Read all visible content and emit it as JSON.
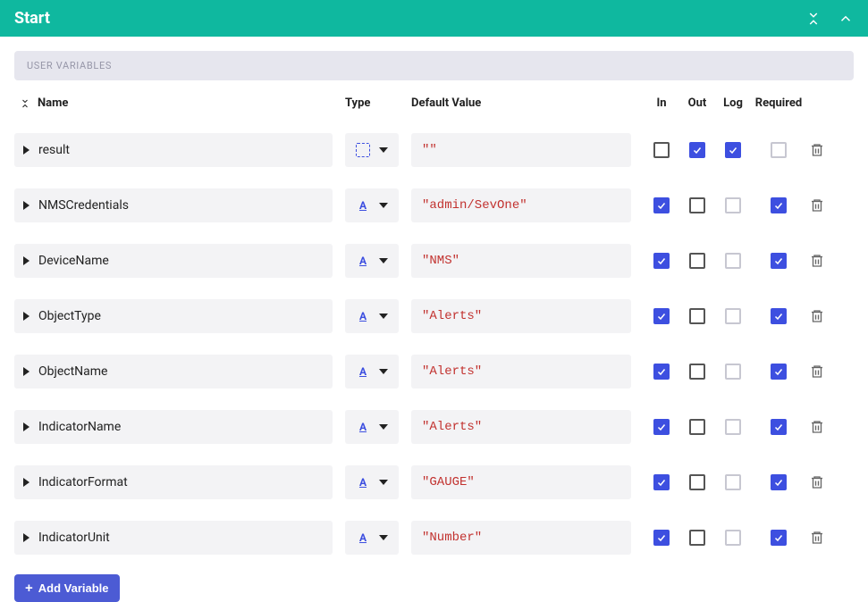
{
  "header": {
    "title": "Start"
  },
  "section_label": "USER VARIABLES",
  "columns": {
    "name": "Name",
    "type": "Type",
    "default": "Default Value",
    "in": "In",
    "out": "Out",
    "log": "Log",
    "required": "Required"
  },
  "rows": [
    {
      "name": "result",
      "type": "empty",
      "default": "\"\"",
      "in": false,
      "out": true,
      "log": true,
      "log_disabled": false,
      "required": false,
      "required_disabled": true
    },
    {
      "name": "NMSCredentials",
      "type": "string",
      "default": "\"admin/SevOne\"",
      "in": true,
      "out": false,
      "log": false,
      "log_disabled": true,
      "required": true,
      "required_disabled": false
    },
    {
      "name": "DeviceName",
      "type": "string",
      "default": "\"NMS\"",
      "in": true,
      "out": false,
      "log": false,
      "log_disabled": true,
      "required": true,
      "required_disabled": false
    },
    {
      "name": "ObjectType",
      "type": "string",
      "default": "\"Alerts\"",
      "in": true,
      "out": false,
      "log": false,
      "log_disabled": true,
      "required": true,
      "required_disabled": false
    },
    {
      "name": "ObjectName",
      "type": "string",
      "default": "\"Alerts\"",
      "in": true,
      "out": false,
      "log": false,
      "log_disabled": true,
      "required": true,
      "required_disabled": false
    },
    {
      "name": "IndicatorName",
      "type": "string",
      "default": "\"Alerts\"",
      "in": true,
      "out": false,
      "log": false,
      "log_disabled": true,
      "required": true,
      "required_disabled": false
    },
    {
      "name": "IndicatorFormat",
      "type": "string",
      "default": "\"GAUGE\"",
      "in": true,
      "out": false,
      "log": false,
      "log_disabled": true,
      "required": true,
      "required_disabled": false
    },
    {
      "name": "IndicatorUnit",
      "type": "string",
      "default": "\"Number\"",
      "in": true,
      "out": false,
      "log": false,
      "log_disabled": true,
      "required": true,
      "required_disabled": false
    }
  ],
  "add_button": "Add Variable"
}
